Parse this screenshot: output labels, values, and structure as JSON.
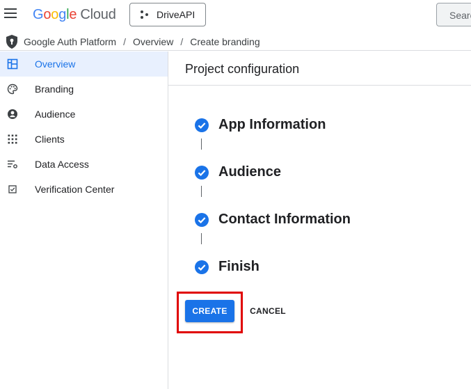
{
  "header": {
    "logo_letters": [
      "G",
      "o",
      "o",
      "g",
      "l",
      "e"
    ],
    "logo_product": "Cloud",
    "project_name": "DriveAPI",
    "search_placeholder": "Search"
  },
  "breadcrumb": {
    "items": [
      "Google Auth Platform",
      "Overview",
      "Create branding"
    ],
    "separator": "/"
  },
  "sidebar": {
    "items": [
      {
        "label": "Overview",
        "icon": "dashboard-icon",
        "active": true
      },
      {
        "label": "Branding",
        "icon": "palette-icon",
        "active": false
      },
      {
        "label": "Audience",
        "icon": "account-circle-icon",
        "active": false
      },
      {
        "label": "Clients",
        "icon": "apps-grid-icon",
        "active": false
      },
      {
        "label": "Data Access",
        "icon": "tune-list-icon",
        "active": false
      },
      {
        "label": "Verification Center",
        "icon": "checkbox-icon",
        "active": false
      }
    ]
  },
  "main": {
    "title": "Project configuration",
    "steps": [
      {
        "label": "App Information",
        "status": "complete"
      },
      {
        "label": "Audience",
        "status": "complete"
      },
      {
        "label": "Contact Information",
        "status": "complete"
      },
      {
        "label": "Finish",
        "status": "complete"
      }
    ],
    "create_label": "CREATE",
    "cancel_label": "CANCEL"
  },
  "colors": {
    "accent": "#1a73e8",
    "active_bg": "#e8f0fe",
    "highlight_border": "#e00000"
  }
}
